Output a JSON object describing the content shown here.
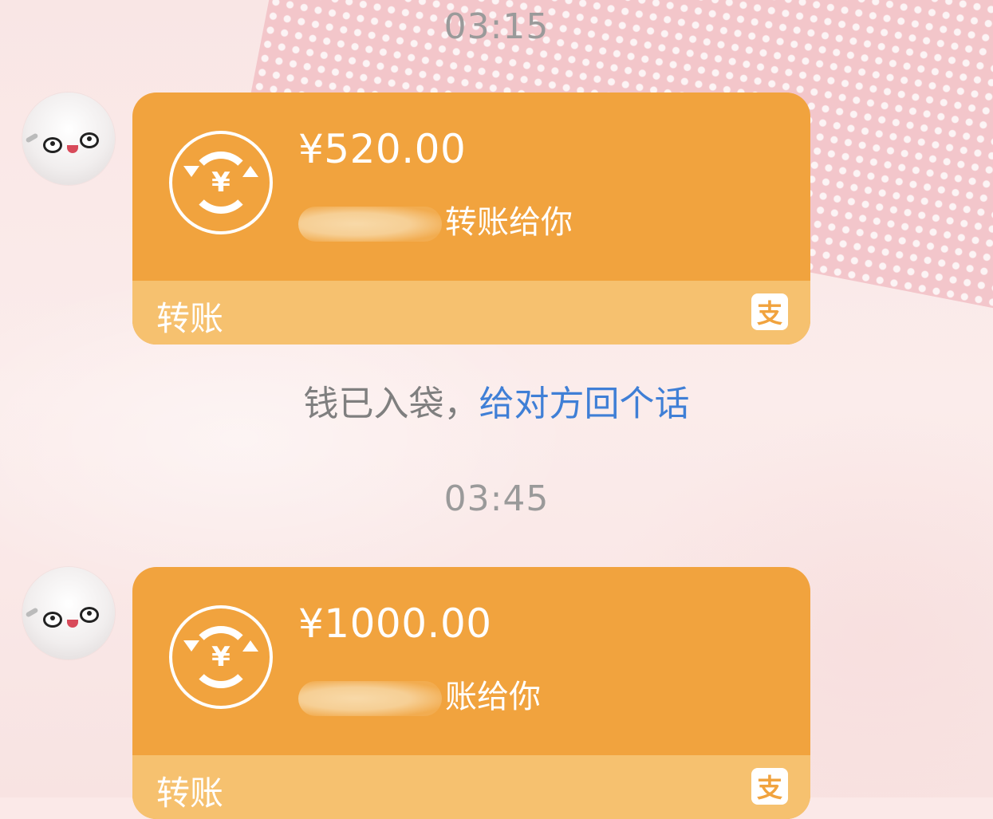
{
  "messages": [
    {
      "time": "03:15",
      "transfer": {
        "amount": "¥520.00",
        "description": "转账给你",
        "label": "转账",
        "coin_icon": "yen-transfer-icon",
        "brand_icon": "alipay-icon",
        "brand_glyph": "支"
      }
    },
    {
      "time": "03:45",
      "transfer": {
        "amount": "¥1000.00",
        "description": "账给你",
        "label": "转账",
        "coin_icon": "yen-transfer-icon",
        "brand_icon": "alipay-icon",
        "brand_glyph": "支"
      }
    }
  ],
  "notice": {
    "text": "钱已入袋，",
    "link": "给对方回个话"
  },
  "coin_symbol": "¥",
  "colors": {
    "card_bg": "#f1a33e",
    "card_footer": "#f6c16f",
    "link": "#3f7fd6",
    "time_text": "#9a9a9a"
  }
}
